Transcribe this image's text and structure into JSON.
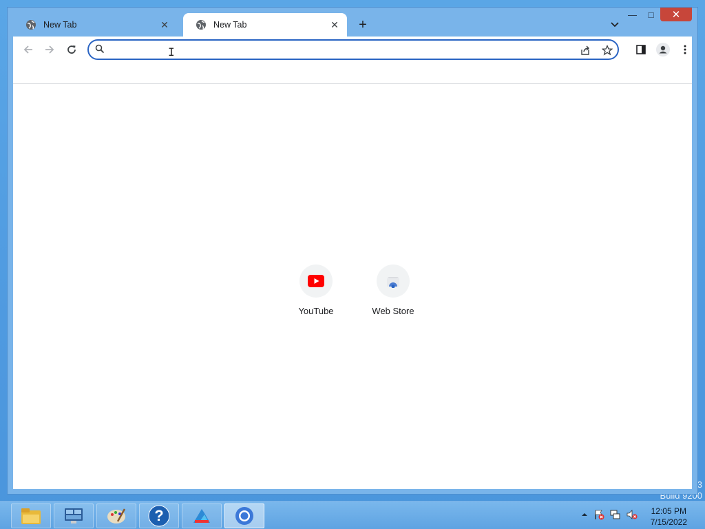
{
  "window": {
    "controls": {
      "minimize": "—",
      "maximize": "□",
      "close": "✕"
    }
  },
  "tabs": [
    {
      "title": "New Tab",
      "active": false
    },
    {
      "title": "New Tab",
      "active": true
    }
  ],
  "toolbar": {
    "omnibox_value": "",
    "omnibox_placeholder": ""
  },
  "shortcuts": [
    {
      "label": "YouTube",
      "icon": "youtube-icon"
    },
    {
      "label": "Web Store",
      "icon": "web-store-icon"
    }
  ],
  "taskbar": {
    "apps": [
      "file-explorer-icon",
      "control-panel-icon",
      "paint-icon",
      "help-icon",
      "app-icon",
      "chrome-icon"
    ],
    "clock": {
      "time": "12:05 PM",
      "date": "7/15/2022"
    }
  },
  "desktop": {
    "watermark_line1": "3",
    "watermark_line2": "Build 9200"
  },
  "colors": {
    "accent": "#2a64c3",
    "close": "#c7463a",
    "youtube_red": "#ff0000"
  }
}
